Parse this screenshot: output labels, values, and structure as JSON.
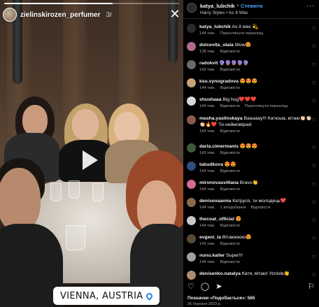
{
  "story": {
    "username": "zielinskirozen_perfumer",
    "time_ago": "3г",
    "progress": 0.62,
    "location": "VIENNA, AUSTRIA",
    "icons": {
      "close": "close-icon",
      "play": "play-icon",
      "pin": "location-pin-icon"
    }
  },
  "post": {
    "author": "katya_lubchik",
    "follow_label": "Стежити",
    "song": "Harry Styles • As It Was",
    "likes_text": "Позначки «Подобається»: 565",
    "date": "26 березня 2023 р."
  },
  "comments": [
    {
      "user": "katya_lubchik",
      "text": "As it was 💫",
      "time": "144 тиж.",
      "reply": "Перегля­нути переклад",
      "likes": "",
      "avatar_color": "#2a2a2a"
    },
    {
      "user": "dolcevita_olala",
      "text": "Wow😍",
      "time": "138 тиж.",
      "reply": "Відповісти",
      "likes": "",
      "avatar_color": "#b06a8e"
    },
    {
      "user": "radokvit",
      "text": "🔮🔮🔮🔮🔮",
      "time": "143 тиж.",
      "reply": "Відповісти",
      "likes": "",
      "avatar_color": "#6a6a6a"
    },
    {
      "user": "ksu.vynogradova",
      "text": "😍😍😍",
      "time": "144 тиж.",
      "reply": "Відповісти",
      "likes": "",
      "avatar_color": "#c9a27a"
    },
    {
      "user": "shushaaa",
      "text": "Big hug❤️❤️❤️",
      "time": "144 тиж.",
      "reply": "Відповісти",
      "extra": "Переглянути переклад",
      "likes": "",
      "avatar_color": "#d8d8d8"
    },
    {
      "user": "masha.yaslinskaya",
      "text": "Вааааау!!! Катюша, вітаю👏🏻👏🏻👏🏻🔥❤️ Ти неймовірна!",
      "time": "144 тиж.",
      "reply": "Відповісти",
      "likes": "",
      "avatar_color": "#8a5a4a"
    },
    {
      "user": "daria.cimermanis",
      "text": "😍😍😍",
      "time": "143 тиж.",
      "reply": "Відповісти",
      "likes": "",
      "avatar_color": "#3e5a3a"
    },
    {
      "user": "tabudkova",
      "text": "😍😍",
      "time": "144 тиж.",
      "reply": "Відповісти",
      "likes": "",
      "avatar_color": "#2f4f7a"
    },
    {
      "user": "mironovasvitlana",
      "text": "Bravo👏",
      "time": "144 тиж.",
      "reply": "Відповісти",
      "likes": "",
      "avatar_color": "#d46a9a"
    },
    {
      "user": "denisovaanna",
      "text": "Катруся, ти молодець❤️",
      "time": "144 тиж.",
      "reply": "Відповісти",
      "extra_first": "1 вподобання",
      "likes": "",
      "avatar_color": "#8a6a4a"
    },
    {
      "user": "thecoat_official",
      "text": "😍",
      "time": "144 тиж.",
      "reply": "Відповісти",
      "likes": "",
      "avatar_color": "#c8c8c8",
      "verified": true
    },
    {
      "user": "evgeni_la",
      "text": "Вітаюююю😍",
      "time": "143 тиж.",
      "reply": "Відповісти",
      "likes": "",
      "avatar_color": "#5a4a3a"
    },
    {
      "user": "nunu.kaller",
      "text": "Super!!!",
      "time": "144 тиж.",
      "reply": "Відповісти",
      "likes": "",
      "avatar_color": "#a0a0a0"
    },
    {
      "user": "denisenko.natalya",
      "text": "Катя, вітаю! Успіхів👏",
      "time": "",
      "reply": "",
      "likes": "",
      "avatar_color": "#b08a6a"
    }
  ],
  "actions": {
    "like": "heart-icon",
    "comment": "comment-icon",
    "share": "share-icon",
    "save": "bookmark-icon"
  },
  "colors": {
    "link": "#4aa3f5",
    "muted": "#a8a8a8",
    "background": "#000000"
  }
}
